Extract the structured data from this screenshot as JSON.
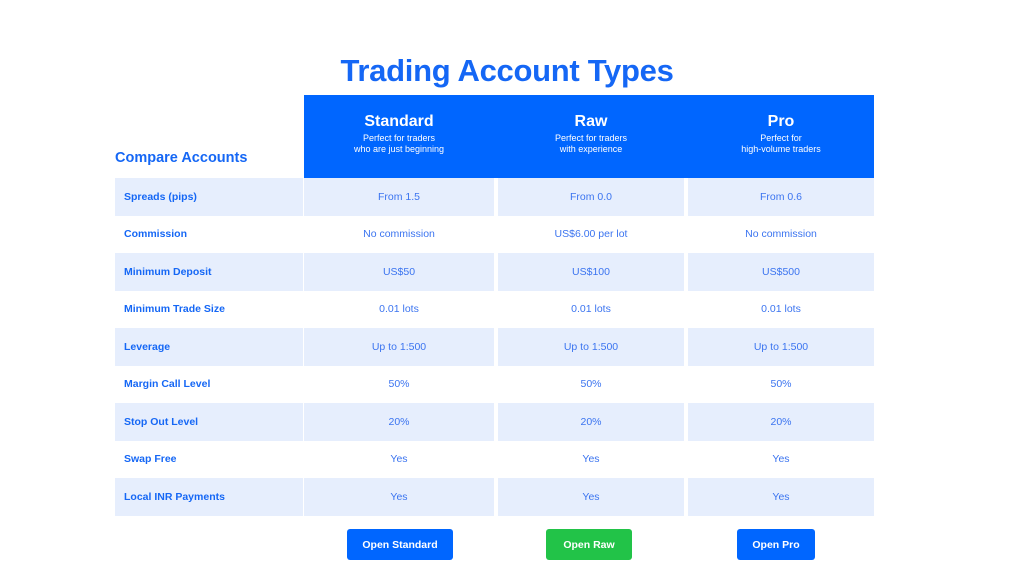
{
  "page": {
    "title": "Trading Account Types",
    "title_color": "#1567f5",
    "background": "#ffffff"
  },
  "table": {
    "compare_label": "Compare Accounts",
    "header_bg": "#0066ff",
    "band_color": "#e6eefd",
    "label_color": "#1567f5",
    "value_color": "#3b74f0",
    "columns": [
      {
        "name": "Standard",
        "subtitle_line1": "Perfect for traders",
        "subtitle_line2": "who are just beginning"
      },
      {
        "name": "Raw",
        "subtitle_line1": "Perfect for traders",
        "subtitle_line2": "with experience"
      },
      {
        "name": "Pro",
        "subtitle_line1": "Perfect for",
        "subtitle_line2": "high-volume traders"
      }
    ],
    "rows": [
      {
        "label": "Spreads (pips)",
        "values": [
          "From 1.5",
          "From 0.0",
          "From 0.6"
        ]
      },
      {
        "label": "Commission",
        "values": [
          "No commission",
          "US$6.00 per lot",
          "No commission"
        ]
      },
      {
        "label": "Minimum Deposit",
        "values": [
          "US$50",
          "US$100",
          "US$500"
        ]
      },
      {
        "label": "Minimum Trade Size",
        "values": [
          "0.01 lots",
          "0.01 lots",
          "0.01 lots"
        ]
      },
      {
        "label": "Leverage",
        "values": [
          "Up to 1:500",
          "Up to 1:500",
          "Up to 1:500"
        ]
      },
      {
        "label": "Margin Call Level",
        "values": [
          "50%",
          "50%",
          "50%"
        ]
      },
      {
        "label": "Stop Out Level",
        "values": [
          "20%",
          "20%",
          "20%"
        ]
      },
      {
        "label": "Swap Free",
        "values": [
          "Yes",
          "Yes",
          "Yes"
        ]
      },
      {
        "label": "Local INR Payments",
        "values": [
          "Yes",
          "Yes",
          "Yes"
        ]
      }
    ]
  },
  "buttons": [
    {
      "label": "Open Standard",
      "color": "#0066ff"
    },
    {
      "label": "Open Raw",
      "color": "#22c348"
    },
    {
      "label": "Open Pro",
      "color": "#0066ff"
    }
  ]
}
